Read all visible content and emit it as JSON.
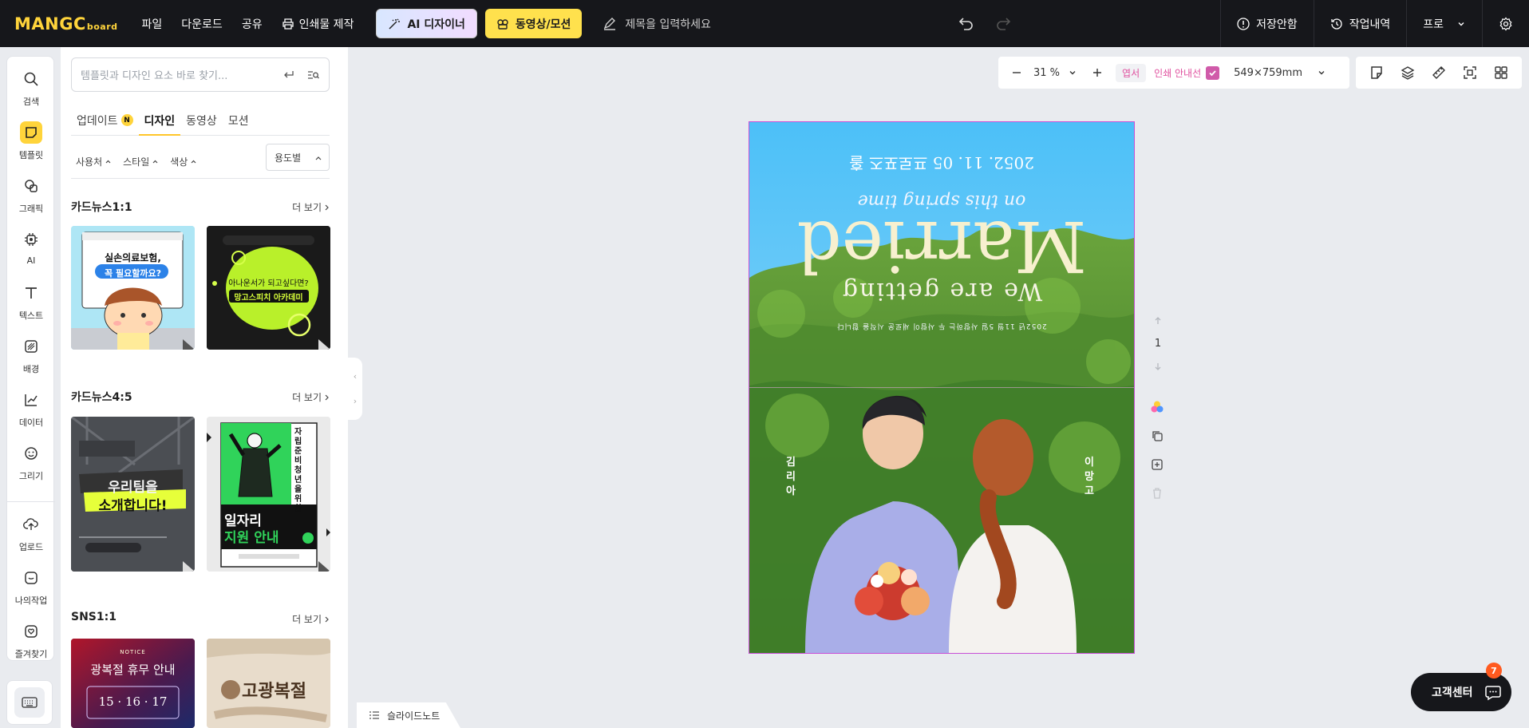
{
  "topbar": {
    "logo_main": "MANGC",
    "logo_sub": "board",
    "menu": [
      "파일",
      "다운로드",
      "공유",
      "인쇄물 제작"
    ],
    "ai_designer": "AI 디자이너",
    "video_motion": "동영상/모션",
    "title_placeholder": "제목을 입력하세요",
    "save_status": "저장안함",
    "history": "작업내역",
    "plan": "프로"
  },
  "rail": {
    "items": [
      "검색",
      "템플릿",
      "그래픽",
      "AI",
      "텍스트",
      "배경",
      "데이터",
      "그리기",
      "업로드",
      "나의작업",
      "즐겨찾기"
    ],
    "active": "템플릿"
  },
  "panel": {
    "search_placeholder": "템플릿과 디자인 요소 바로 찾기...",
    "tabs": [
      "업데이트",
      "디자인",
      "동영상",
      "모션"
    ],
    "update_badge": "N",
    "active_tab": "디자인",
    "filters": [
      "사용처",
      "스타일",
      "색상"
    ],
    "usage_select": "용도별",
    "more_label": "더 보기",
    "sections": [
      {
        "title": "카드뉴스1:1",
        "thumbs": [
          {
            "line1": "실손의료보험,",
            "line2": "꼭 필요할까요?"
          },
          {
            "line1": "아나운서가 되고싶다면?",
            "line2": "망고스피치 아카데미"
          }
        ]
      },
      {
        "title": "카드뉴스4:5",
        "thumbs": [
          {
            "line1": "우리팀을",
            "line2": "소개합니다!"
          },
          {
            "line1": "일자리",
            "line2": "지원 안내",
            "side": "자립준비청년을위한"
          }
        ]
      },
      {
        "title": "SNS1:1",
        "thumbs": [
          {
            "line1": "광복절 휴무 안내",
            "line2": "15 · 16 · 17",
            "top": "NOTICE"
          },
          {
            "line1": "고광복절",
            "line2": ""
          }
        ]
      }
    ]
  },
  "canvas_toolbar": {
    "zoom": "31 %",
    "paper_tag": "엽서",
    "print_guide": "인쇄 안내선",
    "size": "549×759mm"
  },
  "design": {
    "date_line": "2052. 11. 05 프로포즈 홀",
    "script_line": "on this spring time",
    "headline": "Married",
    "subline": "We are getting",
    "small_text": "2052년 11월 5일 사랑하는 두 사람이 새로운 시작을 합니다",
    "left_name": "김리아",
    "right_name": "이망고"
  },
  "page_controls": {
    "page_number": "1"
  },
  "bottom": {
    "slide_note": "슬라이드노트",
    "support": "고객센터",
    "support_badge": "7"
  },
  "colors": {
    "brand_yellow": "#ffd43b",
    "topbar_bg": "#16171b",
    "print_guide_pink": "#e0519f"
  }
}
